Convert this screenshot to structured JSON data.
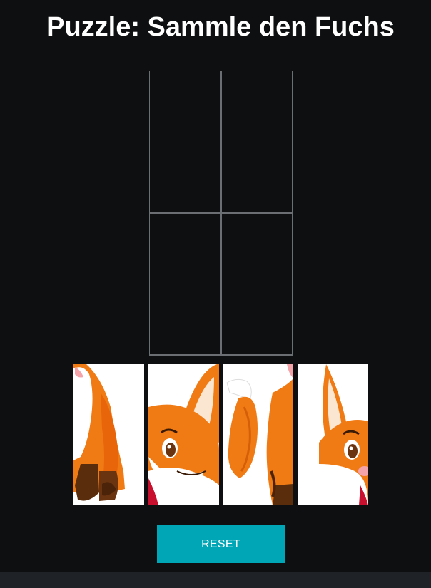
{
  "page": {
    "title": "Puzzle: Sammle den Fuchs"
  },
  "board": {
    "rows": 2,
    "columns": 2,
    "slots_filled": 0
  },
  "pieces": [
    {
      "icon": "fox-body-piece-icon"
    },
    {
      "icon": "fox-face-left-piece-icon"
    },
    {
      "icon": "fox-tail-piece-icon"
    },
    {
      "icon": "fox-face-right-piece-icon"
    }
  ],
  "controls": {
    "reset_label": "RESET"
  },
  "colors": {
    "background": "#0e0f11",
    "grid_line": "#6b6e73",
    "button": "#00a6b6",
    "footer": "#1f2327",
    "fox_orange": "#f07a14",
    "fox_dark": "#5a2d0c"
  }
}
